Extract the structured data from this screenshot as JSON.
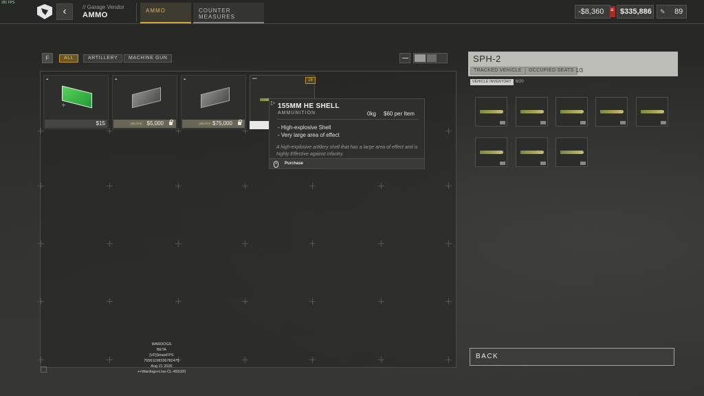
{
  "fps": "281 FPS",
  "header": {
    "breadcrumb": "// Garage Vendor",
    "title": "AMMO",
    "tabs": [
      {
        "label": "AMMO",
        "active": true
      },
      {
        "label": "COUNTER MEASURES",
        "active": false
      }
    ]
  },
  "currency": {
    "delta": "-$8,360",
    "balance": "$335,886",
    "points": "89"
  },
  "filters": {
    "key": "F",
    "items": [
      {
        "label": "ALL",
        "active": true
      },
      {
        "label": "ARTILLERY",
        "active": false
      },
      {
        "label": "MACHINE GUN",
        "active": false
      }
    ]
  },
  "items": [
    {
      "price": "$15",
      "locked": false,
      "unlock_tag": "",
      "icon": "green-ammo-box-icon"
    },
    {
      "price": "$5,000",
      "locked": true,
      "unlock_tag": "UNLOCK",
      "icon": "grey-ammo-box-icon"
    },
    {
      "price": "$75,000",
      "locked": true,
      "unlock_tag": "UNLOCK",
      "icon": "grey-ammo-box-icon"
    }
  ],
  "hovered_item": {
    "quantity": "16",
    "title": "155MM HE SHELL",
    "type": "AMMUNITION",
    "weight": "0kg",
    "price_per_item": "$60 per Item",
    "features": [
      "- High-explosive Shell",
      "- Very large area of effect"
    ],
    "description": "A high-explosive artillery shell that has a large area of effect and is highly Effective against infantry.",
    "action": "Purchase"
  },
  "vehicle": {
    "name": "SPH-2",
    "category": "TRACKED VEHICLE",
    "seats_label": "OCCUPIED SEATS",
    "seats_value": "1/3",
    "inventory_label": "VEHICLE INVENTORY",
    "inventory_count": "8/20",
    "slots": 8
  },
  "back_label": "BACK",
  "build_info": [
    "WARDOGS",
    "BETA",
    "[VF]StratzFPS",
    "76561198336782475",
    "Aug 21 2026",
    "++Wardogs+Live-CL-491020"
  ],
  "colors": {
    "accent": "#d9a63a",
    "alert": "#b3261e",
    "panel_light": "#bdbdb8"
  }
}
